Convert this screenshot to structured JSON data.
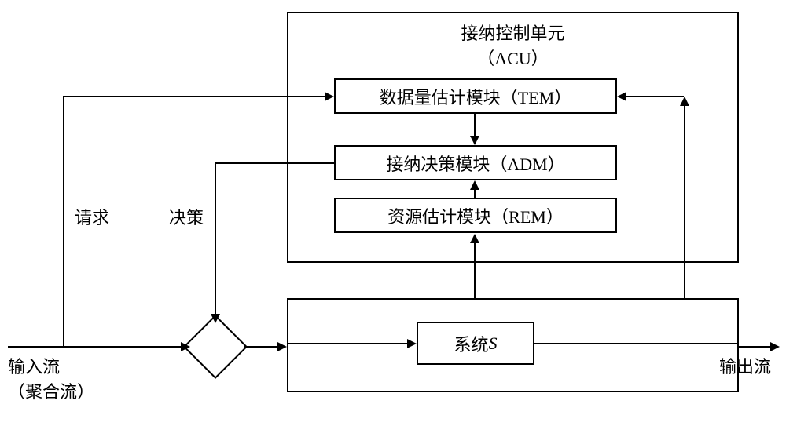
{
  "acu": {
    "title_line1": "接纳控制单元",
    "title_line2": "（ACU）",
    "tem": "数据量估计模块（TEM）",
    "adm": "接纳决策模块（ADM）",
    "rem": "资源估计模块（REM）"
  },
  "system": {
    "label_prefix": "系统",
    "label_s": "S"
  },
  "labels": {
    "request": "请求",
    "decision": "决策",
    "input_line1": "输入流",
    "input_line2": "（聚合流）",
    "output": "输出流"
  }
}
